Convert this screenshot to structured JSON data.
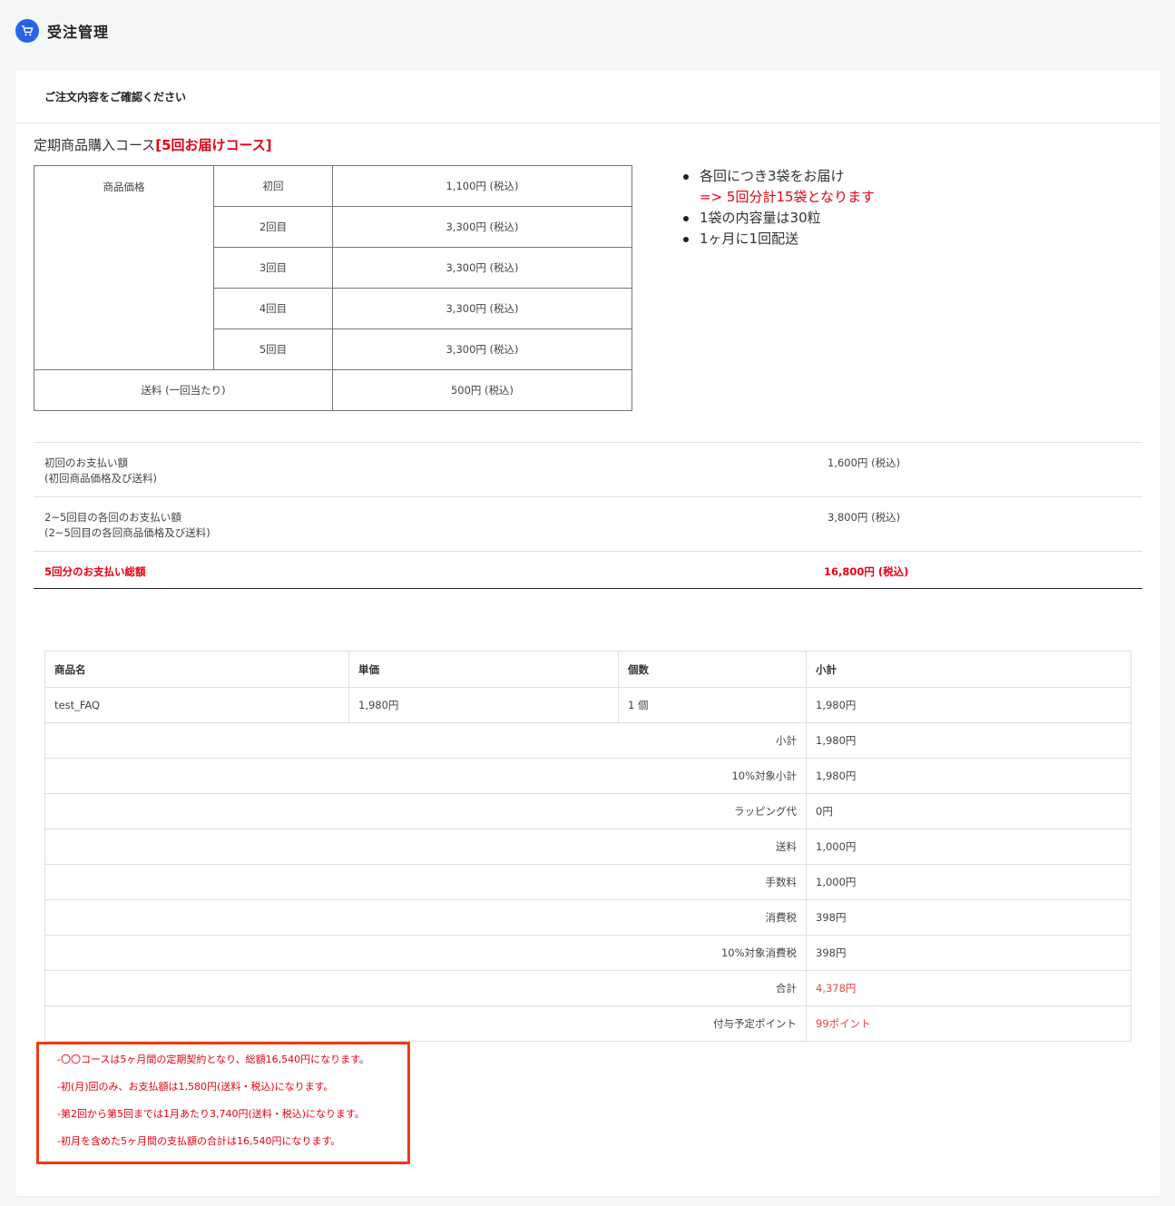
{
  "header": {
    "title": "受注管理",
    "icon": "cart-icon"
  },
  "card": {
    "heading": "ご注文内容をご確認ください"
  },
  "course": {
    "title": "定期商品購入コース",
    "title_highlight": "[5回お届けコース]"
  },
  "price_table": {
    "label": "商品価格",
    "rows": [
      {
        "round": "初回",
        "price": "1,100円 (税込)"
      },
      {
        "round": "2回目",
        "price": "3,300円 (税込)"
      },
      {
        "round": "3回目",
        "price": "3,300円 (税込)"
      },
      {
        "round": "4回目",
        "price": "3,300円 (税込)"
      },
      {
        "round": "5回目",
        "price": "3,300円 (税込)"
      }
    ],
    "shipping_label": "送料 (一回当たり)",
    "shipping_value": "500円 (税込)"
  },
  "notes": {
    "item1": "各回につき3袋をお届け",
    "item1_sub": "=> 5回分計15袋となります",
    "item2": "1袋の内容量は30粒",
    "item3": "1ヶ月に1回配送"
  },
  "summary": {
    "first_label_1": "初回のお支払い額",
    "first_label_2": "(初回商品価格及び送料)",
    "first_value": "1,600円 (税込)",
    "each_label_1": "2~5回目の各回のお支払い額",
    "each_label_2": "(2~5回目の各回商品価格及び送料)",
    "each_value": "3,800円 (税込)",
    "total_label": "5回分のお支払い総額",
    "total_value": "16,800円 (税込)"
  },
  "order_table": {
    "headers": {
      "name": "商品名",
      "unit_price": "単価",
      "quantity": "個数",
      "subtotal": "小計"
    },
    "item": {
      "name": "test_FAQ",
      "unit_price": "1,980円",
      "quantity": "1 個",
      "subtotal": "1,980円"
    },
    "totals": [
      {
        "label": "小計",
        "value": "1,980円"
      },
      {
        "label": "10%対象小計",
        "value": "1,980円"
      },
      {
        "label": "ラッピング代",
        "value": "0円"
      },
      {
        "label": "送料",
        "value": "1,000円"
      },
      {
        "label": "手数料",
        "value": "1,000円"
      },
      {
        "label": "消費税",
        "value": "398円"
      },
      {
        "label": "10%対象消費税",
        "value": "398円"
      },
      {
        "label": "合計",
        "value": "4,378円"
      },
      {
        "label": "付与予定ポイント",
        "value": "99ポイント"
      }
    ]
  },
  "notice": {
    "line1": "-〇〇コースは5ヶ月間の定期契約となり、総額16,540円になります。",
    "line2": "-初(月)回のみ、お支払額は1,580円(送料・税込)になります。",
    "line3": "-第2回から第5回までは1月あたり3,740円(送料・税込)になります。",
    "line4": "-初月を含めた5ヶ月間の支払額の合計は16,540円になります。"
  },
  "colors": {
    "accent": "#2563eb",
    "red": "#e60012",
    "notice_border": "#f03a14"
  }
}
